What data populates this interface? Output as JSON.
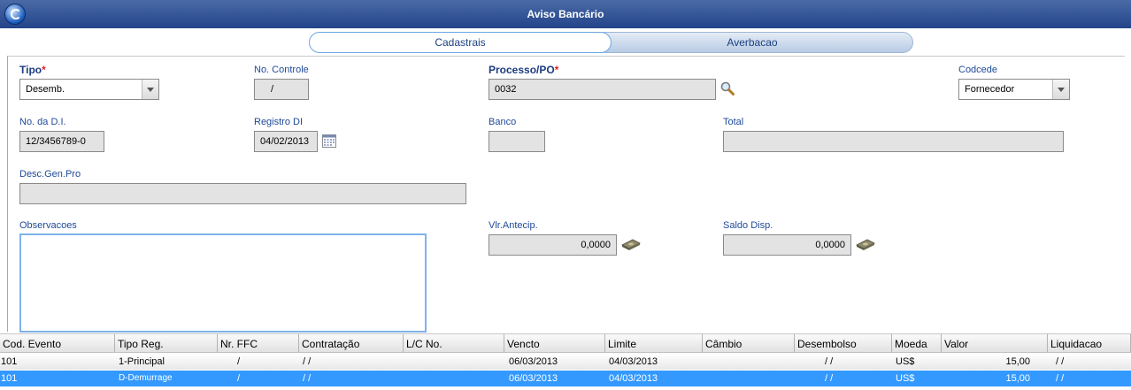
{
  "window": {
    "title": "Aviso Bancário"
  },
  "tabs": [
    {
      "label": "Cadastrais"
    },
    {
      "label": "Averbacao"
    }
  ],
  "form": {
    "tipo": {
      "label": "Tipo",
      "value": "Desemb."
    },
    "no_controle": {
      "label": "No. Controle",
      "value": "/"
    },
    "processo": {
      "label": "Processo/PO",
      "value": "0032"
    },
    "codcede": {
      "label": "Codcede",
      "value": "Fornecedor"
    },
    "no_di": {
      "label": "No. da D.I.",
      "value": "12/3456789-0"
    },
    "registro_di": {
      "label": "Registro DI",
      "value": "04/02/2013"
    },
    "banco": {
      "label": "Banco",
      "value": ""
    },
    "total": {
      "label": "Total",
      "value": ""
    },
    "desc_gen_pro": {
      "label": "Desc.Gen.Pro",
      "value": ""
    },
    "observacoes": {
      "label": "Observacoes",
      "value": ""
    },
    "vlr_antecip": {
      "label": "Vlr.Antecip.",
      "value": "0,0000"
    },
    "saldo_disp": {
      "label": "Saldo Disp.",
      "value": "0,0000"
    },
    "required_mark": "*"
  },
  "grid": {
    "columns": [
      "Cod. Evento",
      "Tipo Reg.",
      "Nr. FFC",
      "Contratação",
      "L/C No.",
      "Vencto",
      "Limite",
      "Câmbio",
      "Desembolso",
      "Moeda",
      "Valor",
      "Liquidacao"
    ],
    "rows": [
      [
        "101",
        "1-Principal",
        "/",
        "/ /",
        "",
        "06/03/2013",
        "04/03/2013",
        "",
        "/ /",
        "US$",
        "15,00",
        "/ /"
      ],
      [
        "101",
        "D-Demurrage",
        "/",
        "/ /",
        "",
        "06/03/2013",
        "04/03/2013",
        "",
        "/ /",
        "US$",
        "15,00",
        "/ /"
      ]
    ],
    "selected_row": 1
  },
  "colors": {
    "title_bar": "#23448a",
    "selection": "#3399ff",
    "label": "#1f4a99",
    "required": "#e02020"
  }
}
